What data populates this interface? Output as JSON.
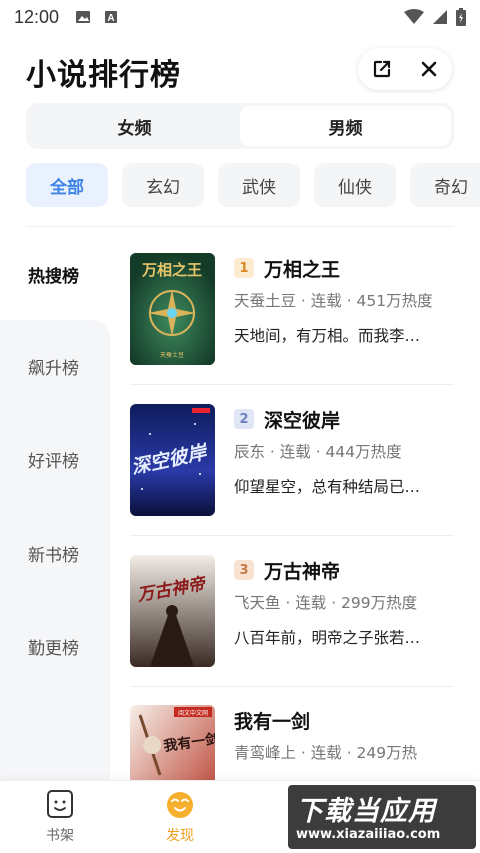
{
  "status_bar": {
    "time": "12:00"
  },
  "header": {
    "title": "小说排行榜"
  },
  "gender_tabs": [
    {
      "label": "女频",
      "active": false
    },
    {
      "label": "男频",
      "active": true
    }
  ],
  "categories": [
    "全部",
    "玄幻",
    "武侠",
    "仙侠",
    "奇幻"
  ],
  "side_menu": [
    "热搜榜",
    "飙升榜",
    "好评榜",
    "新书榜",
    "勤更榜"
  ],
  "books": [
    {
      "rank": "1",
      "title": "万相之王",
      "meta": "天蚕土豆 · 连载 · 451万热度",
      "desc": "天地间，有万相。而我李…",
      "cover_title": "万相之王",
      "cover_author": "天蚕土豆"
    },
    {
      "rank": "2",
      "title": "深空彼岸",
      "meta": "辰东 · 连载 · 444万热度",
      "desc": "仰望星空，总有种结局已…",
      "cover_title": "深空彼岸"
    },
    {
      "rank": "3",
      "title": "万古神帝",
      "meta": "飞天鱼 · 连载 · 299万热度",
      "desc": "八百年前，明帝之子张若…",
      "cover_title": "万古神帝"
    },
    {
      "rank": "",
      "title": "我有一剑",
      "meta": "青鸾峰上 · 连载 · 249万热",
      "desc": "",
      "cover_title": "我有一剑",
      "cover_publisher": "阅文中文网"
    }
  ],
  "bottom_nav": [
    {
      "label": "书架",
      "active": false
    },
    {
      "label": "发现",
      "active": true
    }
  ],
  "watermark": {
    "text": "下载当应用",
    "url": "www.xiazaiiiao.com"
  },
  "colors": {
    "accent": "#3d82e5",
    "nav_active": "#f2a021"
  }
}
